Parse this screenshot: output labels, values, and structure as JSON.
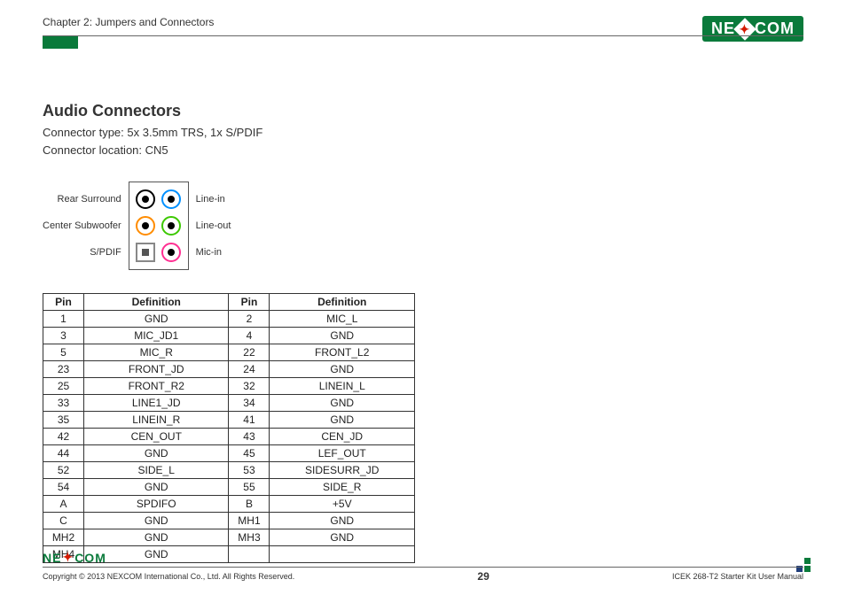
{
  "header": {
    "chapter": "Chapter 2: Jumpers and Connectors",
    "brand": "NEXCOM"
  },
  "section": {
    "title": "Audio Connectors",
    "connector_type": "Connector type: 5x 3.5mm TRS, 1x S/PDIF",
    "connector_location": "Connector location: CN5"
  },
  "jacks": {
    "left": [
      "Rear Surround",
      "Center Subwoofer",
      "S/PDIF"
    ],
    "right": [
      "Line-in",
      "Line-out",
      "Mic-in"
    ]
  },
  "table": {
    "headers": [
      "Pin",
      "Definition",
      "Pin",
      "Definition"
    ],
    "rows": [
      [
        "1",
        "GND",
        "2",
        "MIC_L"
      ],
      [
        "3",
        "MIC_JD1",
        "4",
        "GND"
      ],
      [
        "5",
        "MIC_R",
        "22",
        "FRONT_L2"
      ],
      [
        "23",
        "FRONT_JD",
        "24",
        "GND"
      ],
      [
        "25",
        "FRONT_R2",
        "32",
        "LINEIN_L"
      ],
      [
        "33",
        "LINE1_JD",
        "34",
        "GND"
      ],
      [
        "35",
        "LINEIN_R",
        "41",
        "GND"
      ],
      [
        "42",
        "CEN_OUT",
        "43",
        "CEN_JD"
      ],
      [
        "44",
        "GND",
        "45",
        "LEF_OUT"
      ],
      [
        "52",
        "SIDE_L",
        "53",
        "SIDESURR_JD"
      ],
      [
        "54",
        "GND",
        "55",
        "SIDE_R"
      ],
      [
        "A",
        "SPDIFO",
        "B",
        "+5V"
      ],
      [
        "C",
        "GND",
        "MH1",
        "GND"
      ],
      [
        "MH2",
        "GND",
        "MH3",
        "GND"
      ],
      [
        "MH4",
        "GND",
        "",
        ""
      ]
    ]
  },
  "footer": {
    "copyright": "Copyright © 2013 NEXCOM International Co., Ltd. All Rights Reserved.",
    "page": "29",
    "doc": "ICEK 268-T2 Starter Kit User Manual"
  }
}
